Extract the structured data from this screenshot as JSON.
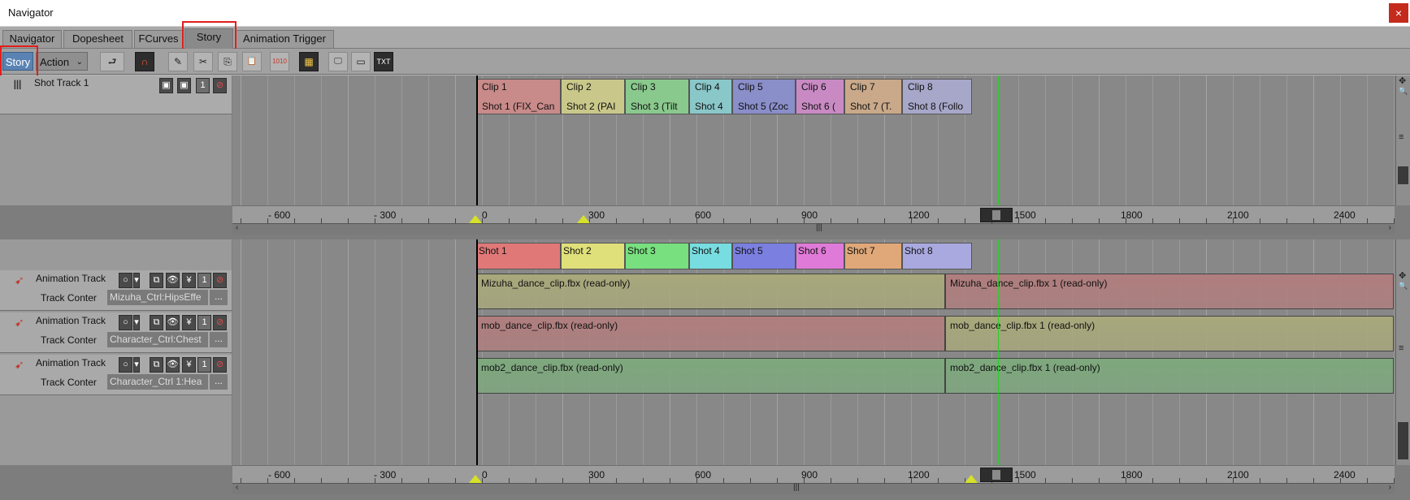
{
  "window": {
    "title": "Navigator",
    "close_glyph": "×"
  },
  "tabs": [
    {
      "label": "Navigator"
    },
    {
      "label": "Dopesheet"
    },
    {
      "label": "FCurves"
    },
    {
      "label": "Story"
    },
    {
      "label": "Animation Trigger"
    }
  ],
  "toolbar": {
    "mode_story": "Story",
    "mode_action": "Action",
    "mode_action_arrow": "⌄",
    "icons": [
      "return-icon",
      "magnet-icon",
      "edit-icon",
      "cut-icon",
      "copy-icon",
      "paste-icon",
      "record-1010-icon",
      "frame-icon",
      "monitor-icon",
      "render-icon",
      "text-icon"
    ],
    "glyphs": [
      "⮐",
      "∩",
      "✎",
      "✂",
      "⎘",
      "📋",
      "1010",
      "▦",
      "🖵",
      "▭",
      "TXT"
    ]
  },
  "shot_track": {
    "name": "Shot Track 1",
    "clips": [
      {
        "clip": "Clip 1",
        "shot": "Shot 1 (FIX_Can",
        "color": "#c98a8a"
      },
      {
        "clip": "Clip 2",
        "shot": "Shot 2 (PAI",
        "color": "#c9c88a"
      },
      {
        "clip": "Clip 3",
        "shot": "Shot 3 (Tilt",
        "color": "#8ac98d"
      },
      {
        "clip": "Clip 4",
        "shot": "Shot 4",
        "color": "#8ac7c9"
      },
      {
        "clip": "Clip 5",
        "shot": "Shot 5 (Zoc",
        "color": "#8a8ec9"
      },
      {
        "clip": "Clip 6",
        "shot": "Shot 6 (",
        "color": "#c98ac4"
      },
      {
        "clip": "Clip 7",
        "shot": "Shot 7 (T.",
        "color": "#c9a98a"
      },
      {
        "clip": "Clip 8",
        "shot": "Shot 8 (Follo",
        "color": "#a7a7c9"
      }
    ]
  },
  "ruler_ticks": [
    "- 600",
    "- 300",
    "0",
    "300",
    "600",
    "900",
    "1200",
    "1500",
    "1800",
    "2100",
    "2400"
  ],
  "shot_strip": [
    {
      "label": "Shot 1",
      "color": "#e07878"
    },
    {
      "label": "Shot 2",
      "color": "#e0e07a"
    },
    {
      "label": "Shot 3",
      "color": "#78e07f"
    },
    {
      "label": "Shot 4",
      "color": "#78dde0"
    },
    {
      "label": "Shot 5",
      "color": "#7a7fe0"
    },
    {
      "label": "Shot 6",
      "color": "#e07ad8"
    },
    {
      "label": "Shot 7",
      "color": "#e0a878"
    },
    {
      "label": "Shot 8",
      "color": "#a9a9e0"
    }
  ],
  "animation_tracks": [
    {
      "name": "Animation Track",
      "content_label": "Track Conter",
      "content_value": "Mizuha_Ctrl:HipsEffe",
      "more": "...",
      "clip_a": "Mizuha_dance_clip.fbx (read-only)",
      "clip_b": "Mizuha_dance_clip.fbx 1 (read-only)",
      "color_a": "#a8a87c",
      "color_b": "#b07e7e"
    },
    {
      "name": "Animation Track",
      "content_label": "Track Conter",
      "content_value": "Character_Ctrl:Chest",
      "more": "...",
      "clip_a": "mob_dance_clip.fbx (read-only)",
      "clip_b": "mob_dance_clip.fbx 1 (read-only)",
      "color_a": "#b07e7e",
      "color_b": "#a8a87c"
    },
    {
      "name": "Animation Track",
      "content_label": "Track Conter",
      "content_value": "Character_Ctrl 1:Hea",
      "more": "...",
      "clip_a": "mob2_dance_clip.fbx (read-only)",
      "clip_b": "mob2_dance_clip.fbx 1 (read-only)",
      "color_a": "#7ea87e",
      "color_b": "#7ea87e"
    }
  ],
  "track_buttons": [
    "○",
    "▾",
    "⧉",
    "👁",
    "¥",
    "1",
    "⊘"
  ],
  "shot_track_buttons": [
    "▣",
    "▣",
    "1",
    "⊘"
  ],
  "scroll_glyphs": {
    "move": "✥",
    "zoom": "🔍",
    "grip": "≡",
    "left": "‹",
    "right": "›",
    "mid": "|||"
  },
  "colors": {
    "accent": "#5a83b3",
    "highlight": "#e21d1d",
    "cursor": "#27d127"
  }
}
